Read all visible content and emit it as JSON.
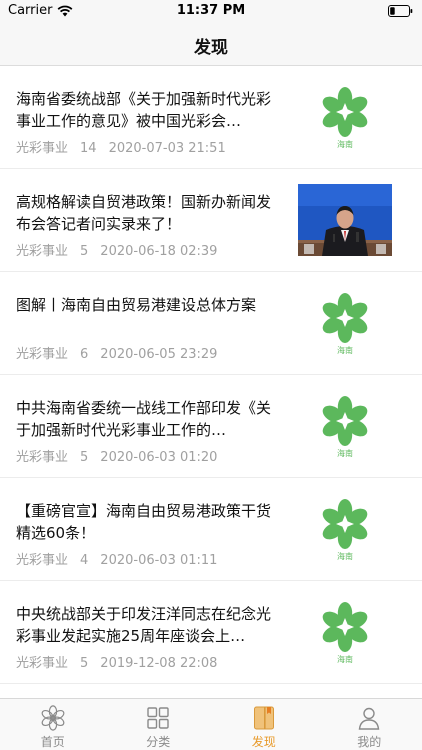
{
  "status_bar": {
    "carrier": "Carrier",
    "time": "11:37 PM"
  },
  "nav": {
    "title": "发现"
  },
  "logo_caption": "海南",
  "articles": [
    {
      "title": "海南省委统战部《关于加强新时代光彩事业工作的意见》被中国光彩会…",
      "source": "光彩事业",
      "views": "14",
      "date": "2020-07-03 21:51",
      "thumb": "logo"
    },
    {
      "title": "高规格解读自贸港政策！国新办新闻发布会答记者问实录来了！",
      "source": "光彩事业",
      "views": "5",
      "date": "2020-06-18 02:39",
      "thumb": "photo"
    },
    {
      "title": "图解丨海南自由贸易港建设总体方案",
      "source": "光彩事业",
      "views": "6",
      "date": "2020-06-05 23:29",
      "thumb": "logo"
    },
    {
      "title": "中共海南省委统一战线工作部印发《关于加强新时代光彩事业工作的…",
      "source": "光彩事业",
      "views": "5",
      "date": "2020-06-03 01:20",
      "thumb": "logo"
    },
    {
      "title": "【重磅官宣】海南自由贸易港政策干货精选60条！",
      "source": "光彩事业",
      "views": "4",
      "date": "2020-06-03 01:11",
      "thumb": "logo"
    },
    {
      "title": "中央统战部关于印发汪洋同志在纪念光彩事业发起实施25周年座谈会上…",
      "source": "光彩事业",
      "views": "5",
      "date": "2019-12-08 22:08",
      "thumb": "logo"
    }
  ],
  "tabs": [
    {
      "label": "首页",
      "icon": "flower-icon"
    },
    {
      "label": "分类",
      "icon": "grid-icon"
    },
    {
      "label": "发现",
      "icon": "book-icon"
    },
    {
      "label": "我的",
      "icon": "person-icon"
    }
  ],
  "active_tab": "发现",
  "colors": {
    "accent": "#e89a2a",
    "logo_green": "#5cb85c",
    "meta_gray": "#a0a0a0"
  }
}
